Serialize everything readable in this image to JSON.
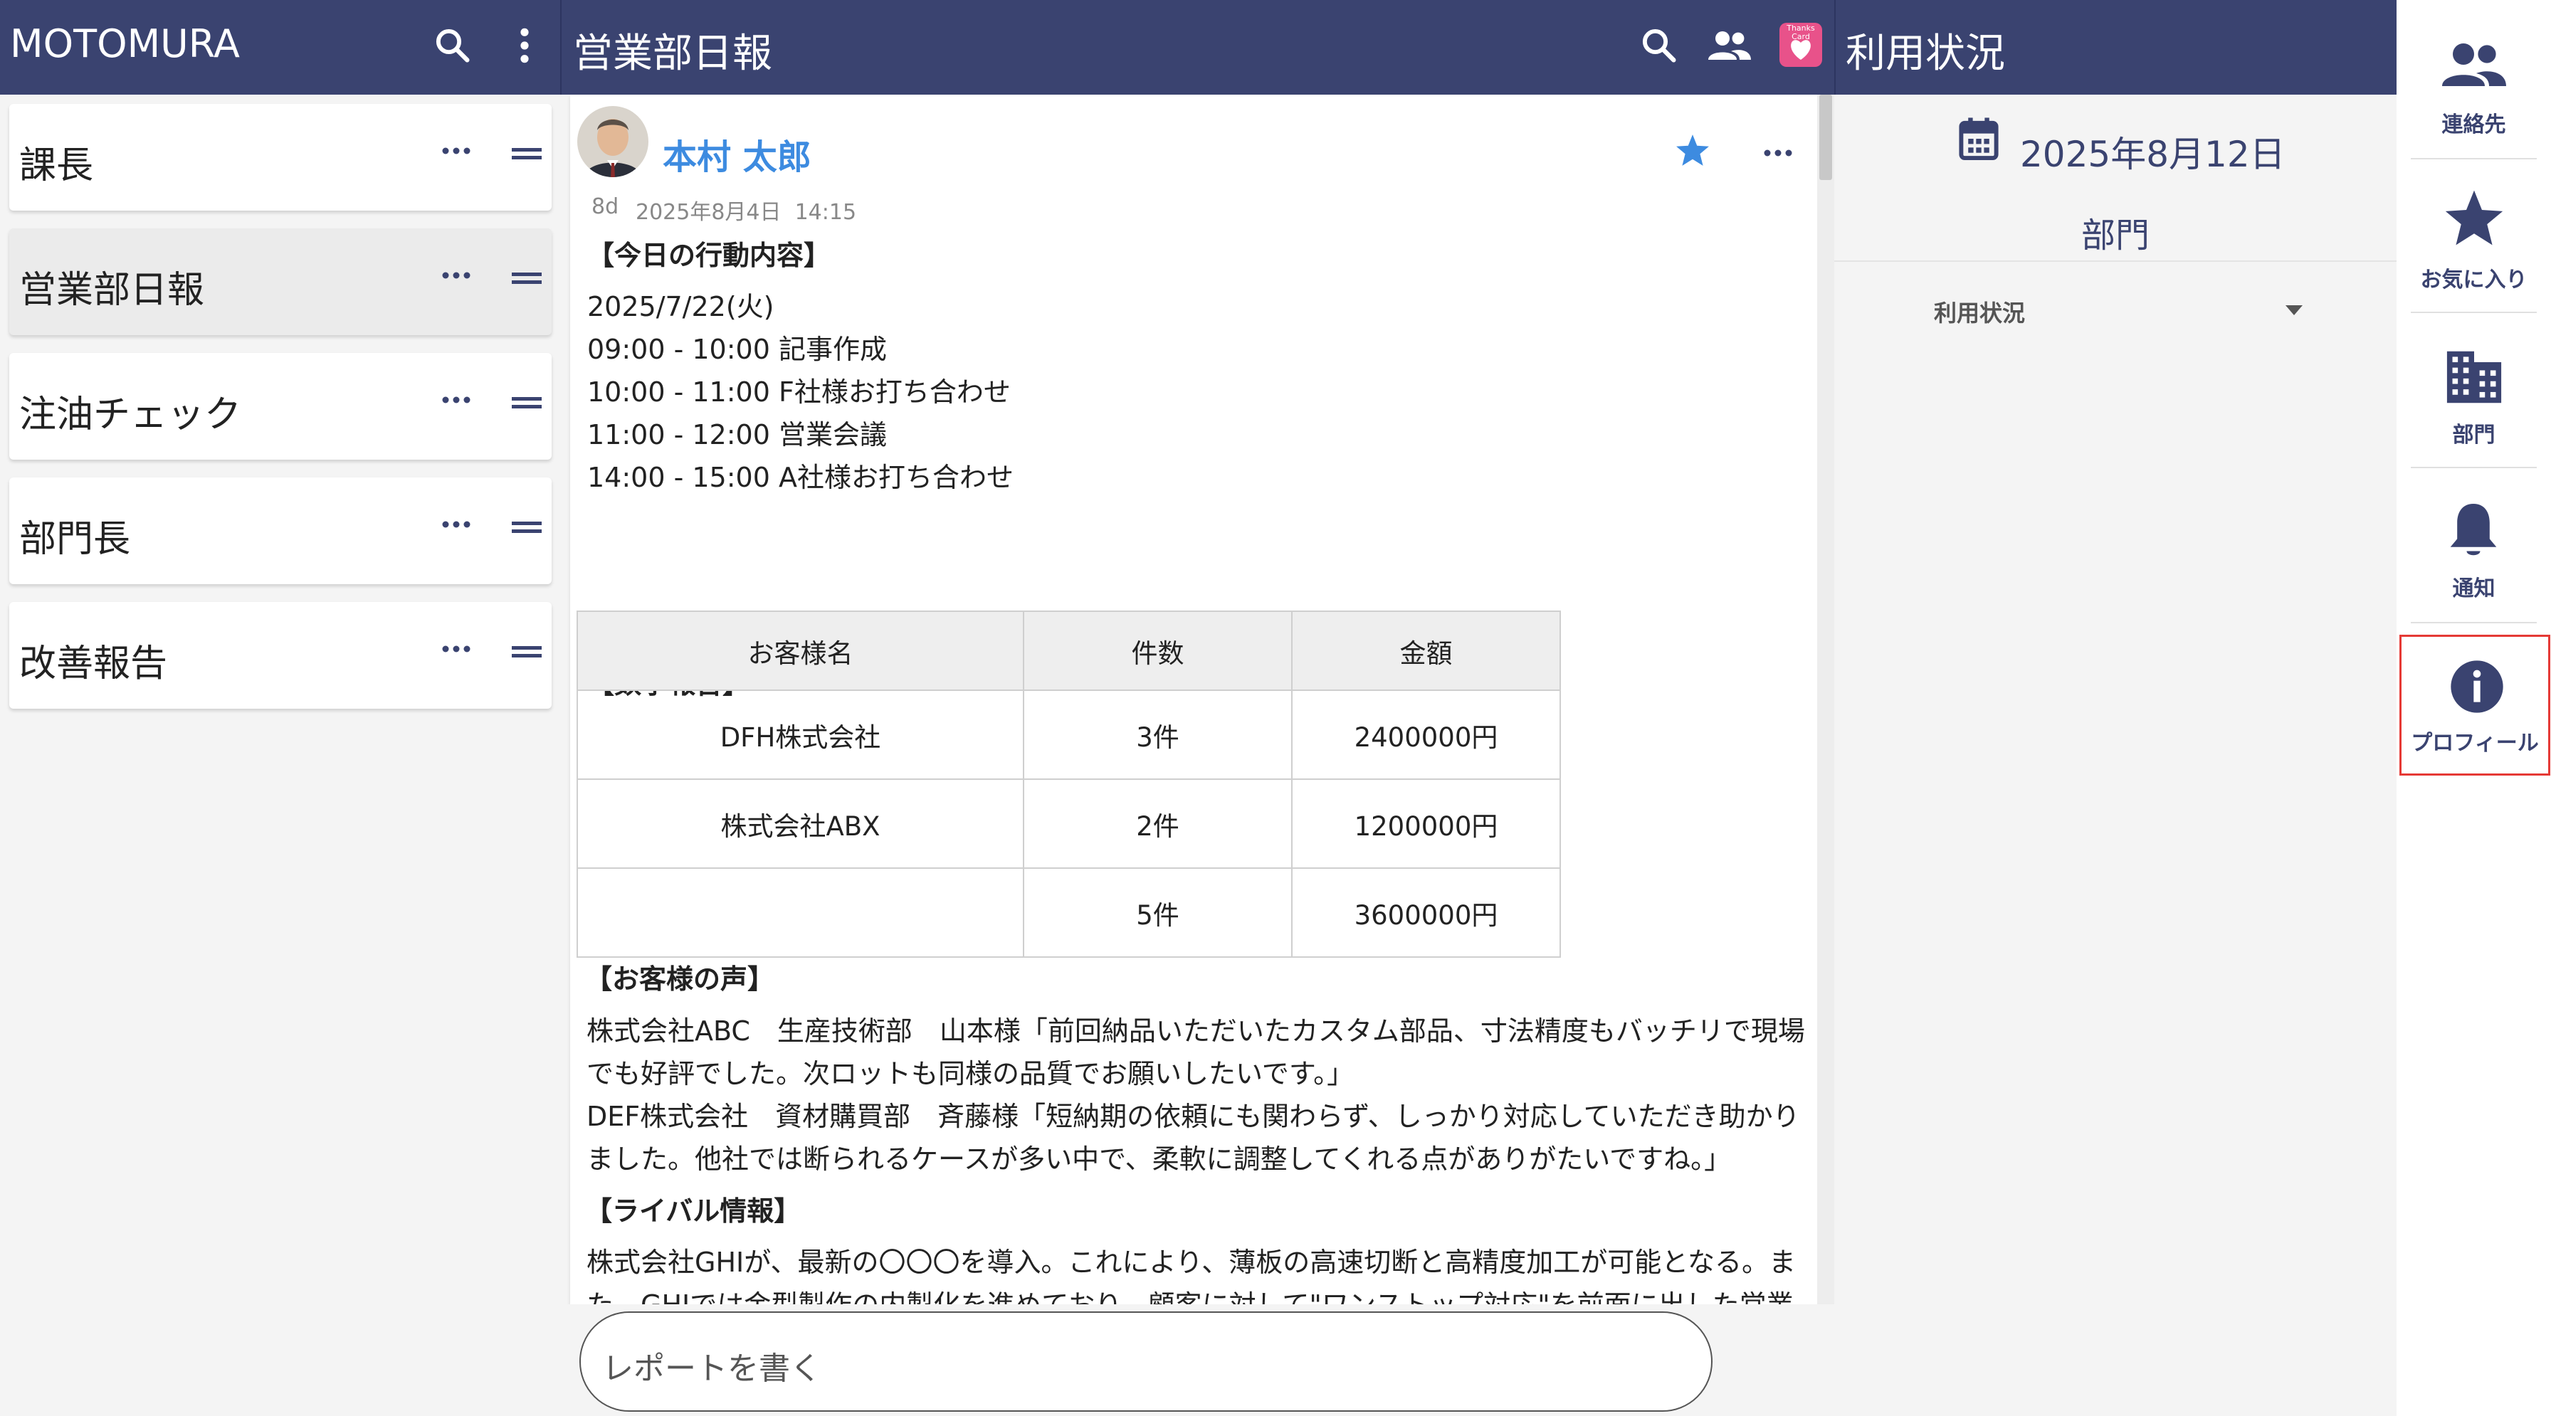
{
  "header": {
    "app_title": "MOTOMURA",
    "channel_title": "営業部日報",
    "panel_title": "利用状況",
    "thanks_card_text": "Thanks Card"
  },
  "sidebar": {
    "items": [
      {
        "label": "課長",
        "active": false
      },
      {
        "label": "営業部日報",
        "active": true
      },
      {
        "label": "注油チェック",
        "active": false
      },
      {
        "label": "部門長",
        "active": false
      },
      {
        "label": "改善報告",
        "active": false
      }
    ]
  },
  "post": {
    "author": "本村 太郎",
    "age": "8d",
    "datetime": "2025年8月4日  14:15",
    "section_activities": "【今日の行動内容】",
    "activities": [
      "2025/7/22(火)",
      "09:00 - 10:00 記事作成",
      "10:00 - 11:00 F社様お打ち合わせ",
      "11:00 - 12:00 営業会議",
      "14:00 - 15:00 A社様お打ち合わせ"
    ],
    "section_numbers": "【数字報告】",
    "table": {
      "headers": [
        "お客様名",
        "件数",
        "金額"
      ],
      "rows": [
        [
          "DFH株式会社",
          "3件",
          "2400000円"
        ],
        [
          "株式会社ABX",
          "2件",
          "1200000円"
        ],
        [
          "",
          "5件",
          "3600000円"
        ]
      ]
    },
    "section_voice": "【お客様の声】",
    "voice_lines": [
      "株式会社ABC　生産技術部　山本様「前回納品いただいたカスタム部品、寸法精度もバッチリで現場",
      "でも好評でした。次ロットも同様の品質でお願いしたいです。」",
      "DEF株式会社　資材購買部　斉藤様「短納期の依頼にも関わらず、しっかり対応していただき助かり",
      "ました。他社では断られるケースが多い中で、柔軟に調整してくれる点がありがたいですね。」"
    ],
    "section_rival": "【ライバル情報】",
    "rival_lines": [
      "株式会社GHIが、最新の〇〇〇を導入。これにより、薄板の高速切断と高精度加工が可能となる。ま",
      "た、GHIでは金型製作の内製化を進めており、顧客に対して\"ワンストップ対応\"を前面に出した営業"
    ]
  },
  "composer": {
    "placeholder": "レポートを書く"
  },
  "usage_panel": {
    "date": "2025年8月12日",
    "department": "部門",
    "dropdown_label": "利用状況"
  },
  "side_nav": {
    "items": [
      {
        "label": "連絡先",
        "icon": "contacts-icon"
      },
      {
        "label": "お気に入り",
        "icon": "star-icon"
      },
      {
        "label": "部門",
        "icon": "building-icon"
      },
      {
        "label": "通知",
        "icon": "bell-icon"
      },
      {
        "label": "プロフィール",
        "icon": "info-icon"
      }
    ],
    "highlight_color": "#e53935"
  },
  "colors": {
    "header_bg": "#3a4370",
    "accent_blue": "#3d8be0",
    "nav_icon": "#3a4370",
    "thanks_card_bg": "#e8528a"
  }
}
